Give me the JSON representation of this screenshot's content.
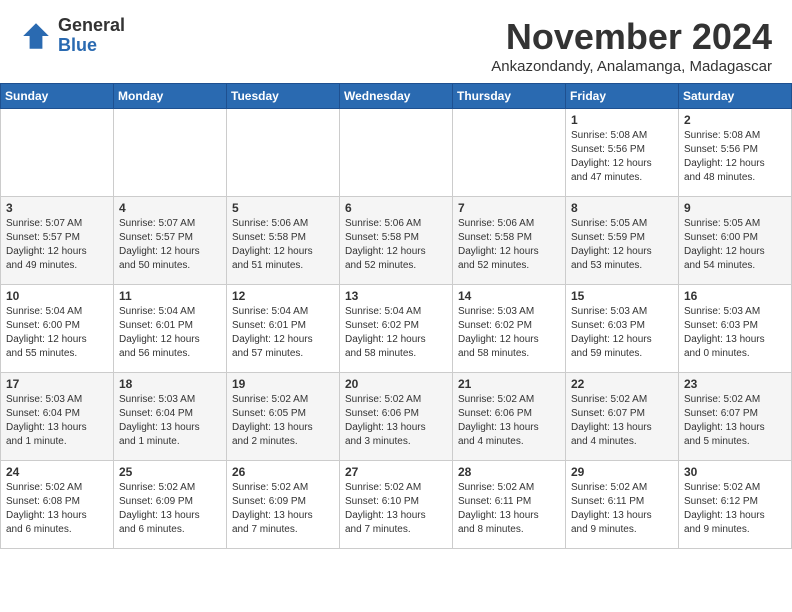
{
  "logo": {
    "general": "General",
    "blue": "Blue"
  },
  "header": {
    "month": "November 2024",
    "location": "Ankazondandy, Analamanga, Madagascar"
  },
  "weekdays": [
    "Sunday",
    "Monday",
    "Tuesday",
    "Wednesday",
    "Thursday",
    "Friday",
    "Saturday"
  ],
  "weeks": [
    [
      {
        "day": "",
        "info": ""
      },
      {
        "day": "",
        "info": ""
      },
      {
        "day": "",
        "info": ""
      },
      {
        "day": "",
        "info": ""
      },
      {
        "day": "",
        "info": ""
      },
      {
        "day": "1",
        "info": "Sunrise: 5:08 AM\nSunset: 5:56 PM\nDaylight: 12 hours\nand 47 minutes."
      },
      {
        "day": "2",
        "info": "Sunrise: 5:08 AM\nSunset: 5:56 PM\nDaylight: 12 hours\nand 48 minutes."
      }
    ],
    [
      {
        "day": "3",
        "info": "Sunrise: 5:07 AM\nSunset: 5:57 PM\nDaylight: 12 hours\nand 49 minutes."
      },
      {
        "day": "4",
        "info": "Sunrise: 5:07 AM\nSunset: 5:57 PM\nDaylight: 12 hours\nand 50 minutes."
      },
      {
        "day": "5",
        "info": "Sunrise: 5:06 AM\nSunset: 5:58 PM\nDaylight: 12 hours\nand 51 minutes."
      },
      {
        "day": "6",
        "info": "Sunrise: 5:06 AM\nSunset: 5:58 PM\nDaylight: 12 hours\nand 52 minutes."
      },
      {
        "day": "7",
        "info": "Sunrise: 5:06 AM\nSunset: 5:58 PM\nDaylight: 12 hours\nand 52 minutes."
      },
      {
        "day": "8",
        "info": "Sunrise: 5:05 AM\nSunset: 5:59 PM\nDaylight: 12 hours\nand 53 minutes."
      },
      {
        "day": "9",
        "info": "Sunrise: 5:05 AM\nSunset: 6:00 PM\nDaylight: 12 hours\nand 54 minutes."
      }
    ],
    [
      {
        "day": "10",
        "info": "Sunrise: 5:04 AM\nSunset: 6:00 PM\nDaylight: 12 hours\nand 55 minutes."
      },
      {
        "day": "11",
        "info": "Sunrise: 5:04 AM\nSunset: 6:01 PM\nDaylight: 12 hours\nand 56 minutes."
      },
      {
        "day": "12",
        "info": "Sunrise: 5:04 AM\nSunset: 6:01 PM\nDaylight: 12 hours\nand 57 minutes."
      },
      {
        "day": "13",
        "info": "Sunrise: 5:04 AM\nSunset: 6:02 PM\nDaylight: 12 hours\nand 58 minutes."
      },
      {
        "day": "14",
        "info": "Sunrise: 5:03 AM\nSunset: 6:02 PM\nDaylight: 12 hours\nand 58 minutes."
      },
      {
        "day": "15",
        "info": "Sunrise: 5:03 AM\nSunset: 6:03 PM\nDaylight: 12 hours\nand 59 minutes."
      },
      {
        "day": "16",
        "info": "Sunrise: 5:03 AM\nSunset: 6:03 PM\nDaylight: 13 hours\nand 0 minutes."
      }
    ],
    [
      {
        "day": "17",
        "info": "Sunrise: 5:03 AM\nSunset: 6:04 PM\nDaylight: 13 hours\nand 1 minute."
      },
      {
        "day": "18",
        "info": "Sunrise: 5:03 AM\nSunset: 6:04 PM\nDaylight: 13 hours\nand 1 minute."
      },
      {
        "day": "19",
        "info": "Sunrise: 5:02 AM\nSunset: 6:05 PM\nDaylight: 13 hours\nand 2 minutes."
      },
      {
        "day": "20",
        "info": "Sunrise: 5:02 AM\nSunset: 6:06 PM\nDaylight: 13 hours\nand 3 minutes."
      },
      {
        "day": "21",
        "info": "Sunrise: 5:02 AM\nSunset: 6:06 PM\nDaylight: 13 hours\nand 4 minutes."
      },
      {
        "day": "22",
        "info": "Sunrise: 5:02 AM\nSunset: 6:07 PM\nDaylight: 13 hours\nand 4 minutes."
      },
      {
        "day": "23",
        "info": "Sunrise: 5:02 AM\nSunset: 6:07 PM\nDaylight: 13 hours\nand 5 minutes."
      }
    ],
    [
      {
        "day": "24",
        "info": "Sunrise: 5:02 AM\nSunset: 6:08 PM\nDaylight: 13 hours\nand 6 minutes."
      },
      {
        "day": "25",
        "info": "Sunrise: 5:02 AM\nSunset: 6:09 PM\nDaylight: 13 hours\nand 6 minutes."
      },
      {
        "day": "26",
        "info": "Sunrise: 5:02 AM\nSunset: 6:09 PM\nDaylight: 13 hours\nand 7 minutes."
      },
      {
        "day": "27",
        "info": "Sunrise: 5:02 AM\nSunset: 6:10 PM\nDaylight: 13 hours\nand 7 minutes."
      },
      {
        "day": "28",
        "info": "Sunrise: 5:02 AM\nSunset: 6:11 PM\nDaylight: 13 hours\nand 8 minutes."
      },
      {
        "day": "29",
        "info": "Sunrise: 5:02 AM\nSunset: 6:11 PM\nDaylight: 13 hours\nand 9 minutes."
      },
      {
        "day": "30",
        "info": "Sunrise: 5:02 AM\nSunset: 6:12 PM\nDaylight: 13 hours\nand 9 minutes."
      }
    ]
  ]
}
